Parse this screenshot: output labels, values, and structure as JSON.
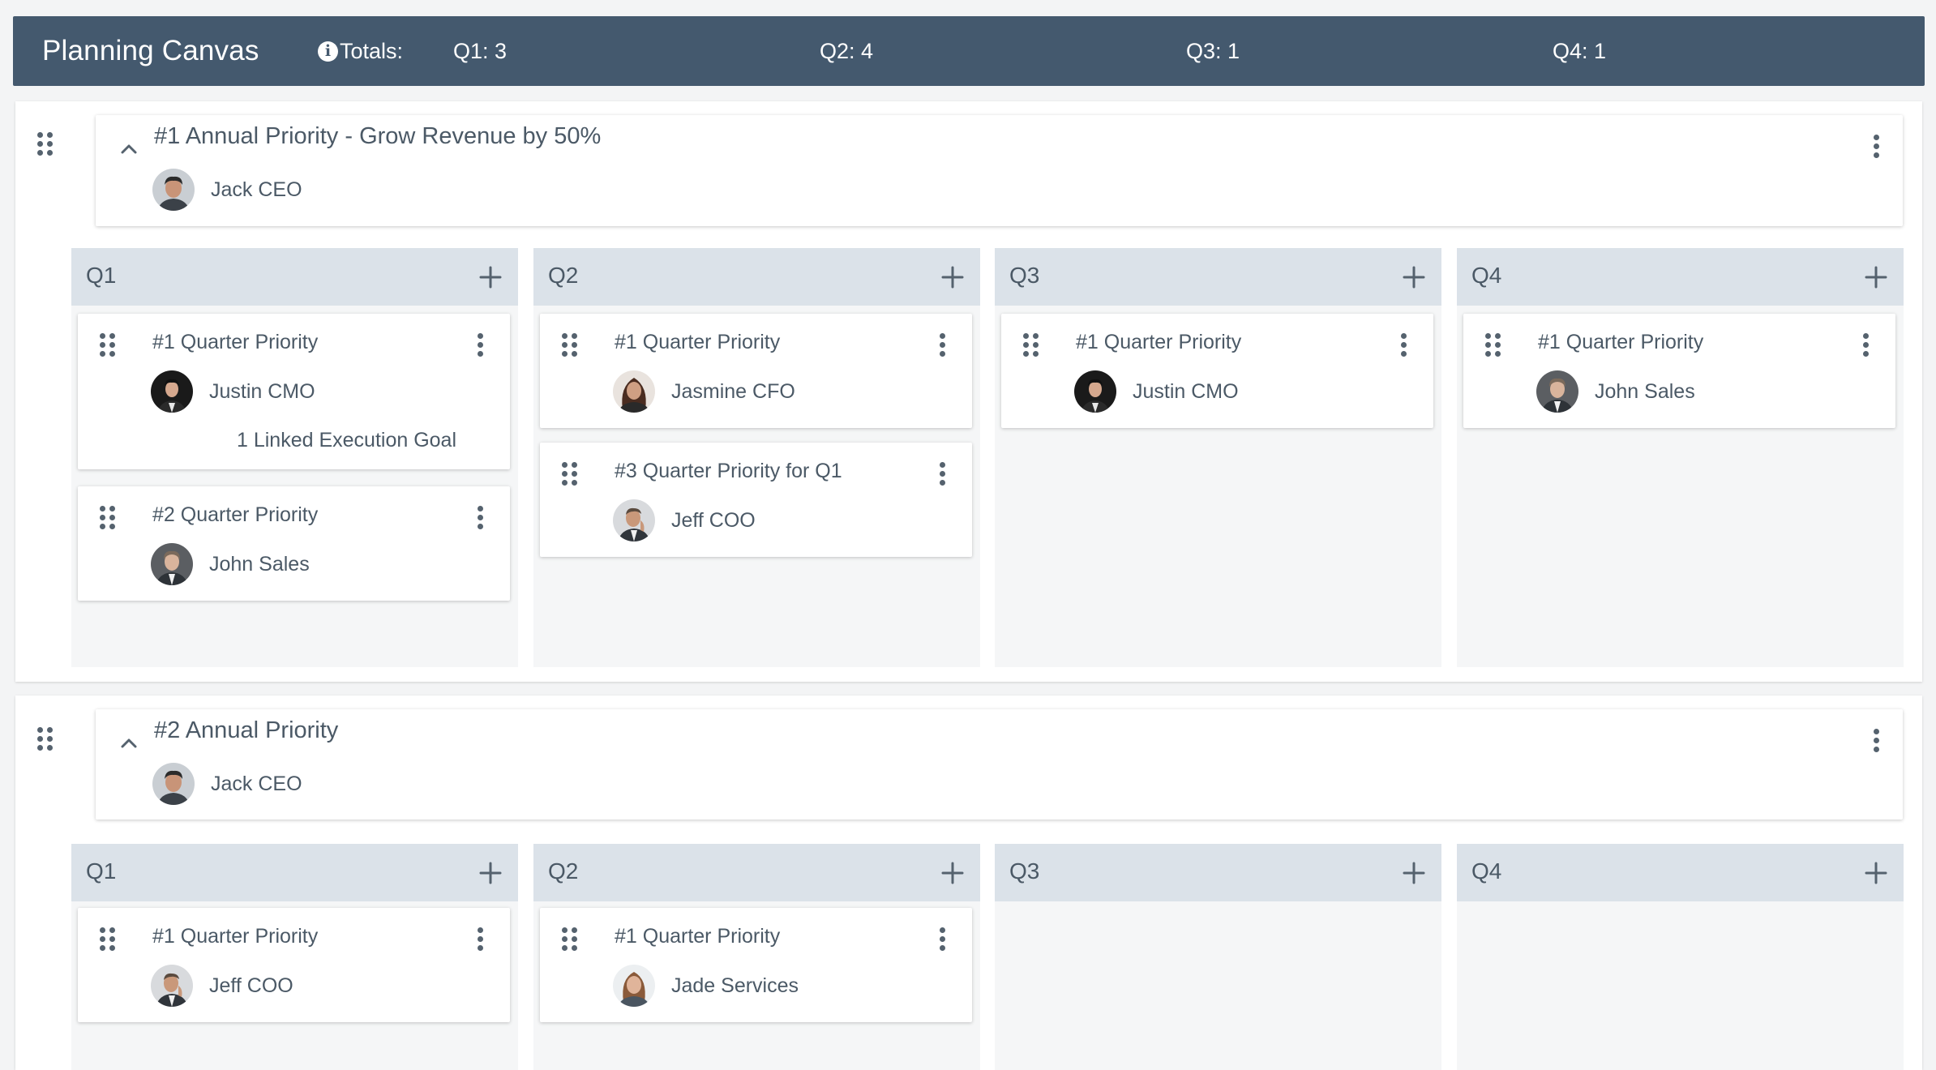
{
  "header": {
    "title": "Planning Canvas",
    "totals_label": "Totals:",
    "info_icon": "info-icon",
    "totals": [
      "Q1: 3",
      "Q2: 4",
      "Q3: 1",
      "Q4: 1"
    ]
  },
  "colors": {
    "header_bg": "#44596e",
    "column_head_bg": "#dbe2e9",
    "text": "#4b5966"
  },
  "sections": [
    {
      "title": "#1 Annual Priority - Grow Revenue by 50%",
      "owner": "Jack CEO",
      "columns": [
        {
          "label": "Q1",
          "cards": [
            {
              "title": "#1 Quarter Priority",
              "owner": "Justin CMO",
              "linked": "1 Linked Execution Goal"
            },
            {
              "title": "#2 Quarter Priority",
              "owner": "John Sales"
            }
          ]
        },
        {
          "label": "Q2",
          "cards": [
            {
              "title": "#1 Quarter Priority",
              "owner": "Jasmine CFO"
            },
            {
              "title": "#3 Quarter Priority for Q1",
              "owner": "Jeff COO"
            }
          ]
        },
        {
          "label": "Q3",
          "cards": [
            {
              "title": "#1 Quarter Priority",
              "owner": "Justin CMO"
            }
          ]
        },
        {
          "label": "Q4",
          "cards": [
            {
              "title": "#1 Quarter Priority",
              "owner": "John Sales"
            }
          ]
        }
      ]
    },
    {
      "title": "#2 Annual Priority",
      "owner": "Jack CEO",
      "columns": [
        {
          "label": "Q1",
          "cards": [
            {
              "title": "#1 Quarter Priority",
              "owner": "Jeff COO"
            }
          ]
        },
        {
          "label": "Q2",
          "cards": [
            {
              "title": "#1 Quarter Priority",
              "owner": "Jade Services"
            }
          ]
        },
        {
          "label": "Q3",
          "cards": []
        },
        {
          "label": "Q4",
          "cards": []
        }
      ]
    }
  ]
}
